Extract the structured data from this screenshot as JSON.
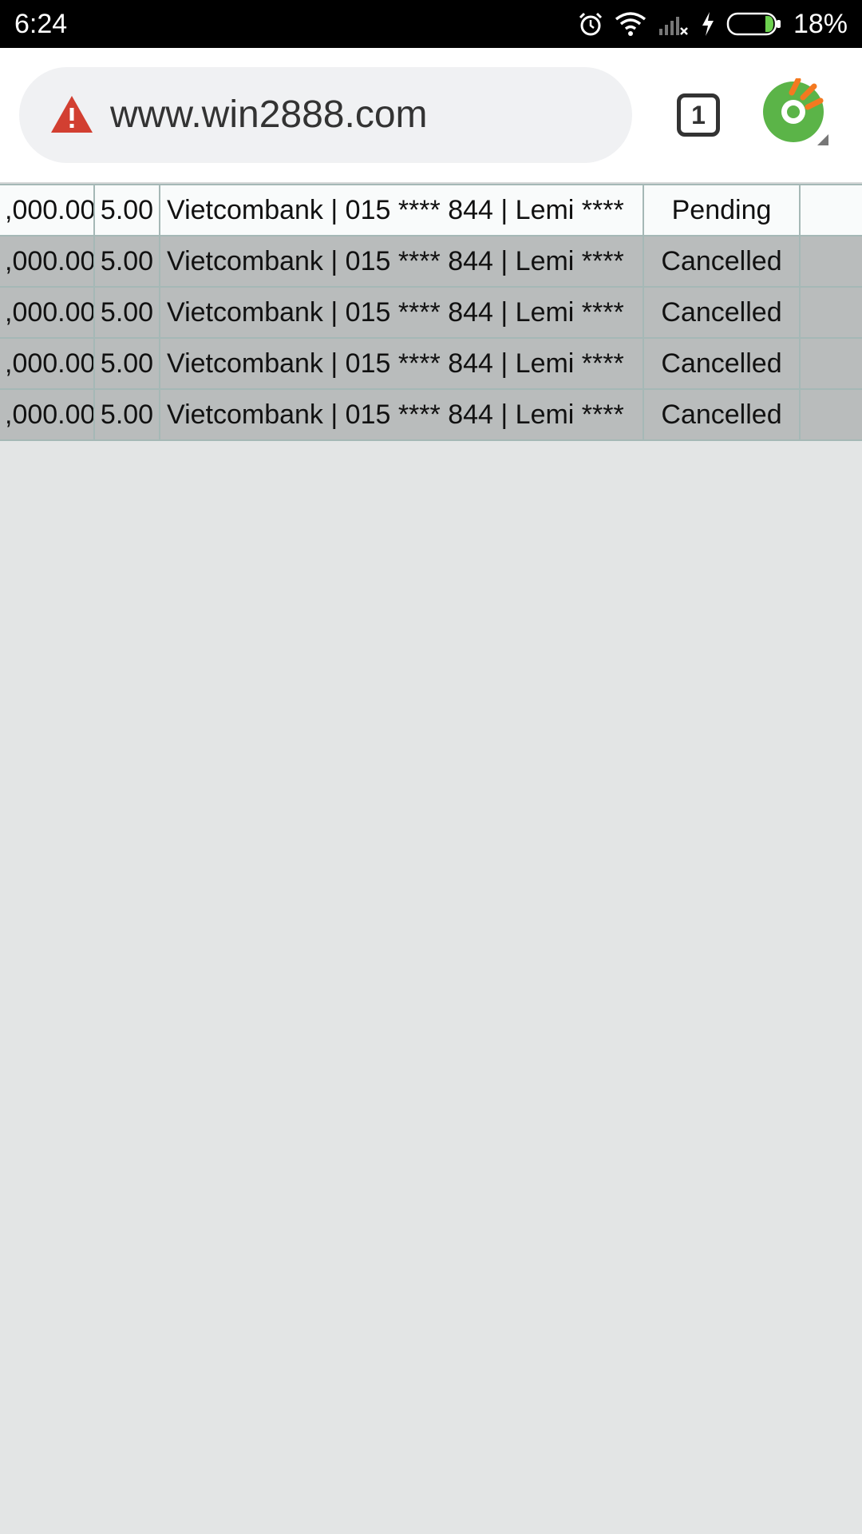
{
  "status_bar": {
    "time": "6:24",
    "battery_percent": "18%",
    "battery_level": 0.18,
    "icons": [
      "alarm-icon",
      "wifi-icon",
      "signal-no-service-icon",
      "charging-icon",
      "battery-icon"
    ]
  },
  "browser": {
    "url": "www.win2888.com",
    "security_icon": "warning-triangle-icon",
    "security_color": "#d23f31",
    "tab_count": "1",
    "logo_icon": "coc-coc-browser-logo-icon",
    "logo_colors": {
      "green": "#5bb448",
      "orange": "#f47920"
    }
  },
  "table": {
    "row_colors": {
      "first": "#f9fbfb",
      "rest": "#b9bcbc",
      "border": "#a5b8b6"
    },
    "rows": [
      {
        "amount": ",000.00",
        "fee": "5.00",
        "bank": "Vietcombank | 015 **** 844 | Lemi ****",
        "status": "Pending"
      },
      {
        "amount": ",000.00",
        "fee": "5.00",
        "bank": "Vietcombank | 015 **** 844 | Lemi ****",
        "status": "Cancelled"
      },
      {
        "amount": ",000.00",
        "fee": "5.00",
        "bank": "Vietcombank | 015 **** 844 | Lemi ****",
        "status": "Cancelled"
      },
      {
        "amount": ",000.00",
        "fee": "5.00",
        "bank": "Vietcombank | 015 **** 844 | Lemi ****",
        "status": "Cancelled"
      },
      {
        "amount": ",000.00",
        "fee": "5.00",
        "bank": "Vietcombank | 015 **** 844 | Lemi ****",
        "status": "Cancelled"
      }
    ]
  }
}
